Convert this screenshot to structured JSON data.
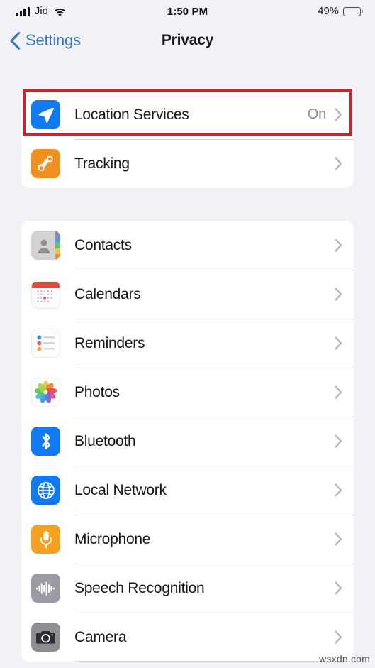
{
  "status_bar": {
    "carrier": "Jio",
    "wifi_icon": "wifi-icon",
    "signal_icon": "cellular-signal-icon",
    "time": "1:50 PM",
    "battery_percent": "49%",
    "battery_level": 49
  },
  "nav": {
    "back_label": "Settings",
    "back_icon": "chevron-left-icon",
    "title": "Privacy"
  },
  "groups": [
    {
      "id": "privacy",
      "rows": [
        {
          "label": "Location Services",
          "value": "On",
          "icon": "location-arrow-icon",
          "icon_class": "ic-location",
          "name": "location-services",
          "highlighted": true
        },
        {
          "label": "Tracking",
          "value": "",
          "icon": "tracking-icon",
          "icon_class": "ic-tracking",
          "name": "tracking",
          "highlighted": false
        }
      ]
    },
    {
      "id": "permissions",
      "rows": [
        {
          "label": "Contacts",
          "value": "",
          "icon": "contacts-icon",
          "icon_class": "ic-contacts",
          "name": "contacts"
        },
        {
          "label": "Calendars",
          "value": "",
          "icon": "calendar-icon",
          "icon_class": "ic-calendars",
          "name": "calendars"
        },
        {
          "label": "Reminders",
          "value": "",
          "icon": "reminders-icon",
          "icon_class": "ic-reminders",
          "name": "reminders"
        },
        {
          "label": "Photos",
          "value": "",
          "icon": "photos-icon",
          "icon_class": "ic-photos",
          "name": "photos"
        },
        {
          "label": "Bluetooth",
          "value": "",
          "icon": "bluetooth-icon",
          "icon_class": "ic-bluetooth",
          "name": "bluetooth"
        },
        {
          "label": "Local Network",
          "value": "",
          "icon": "globe-icon",
          "icon_class": "ic-localnetwork",
          "name": "local-network"
        },
        {
          "label": "Microphone",
          "value": "",
          "icon": "microphone-icon",
          "icon_class": "ic-microphone",
          "name": "microphone"
        },
        {
          "label": "Speech Recognition",
          "value": "",
          "icon": "waveform-icon",
          "icon_class": "ic-speech",
          "name": "speech-recognition"
        },
        {
          "label": "Camera",
          "value": "",
          "icon": "camera-icon",
          "icon_class": "ic-camera",
          "name": "camera"
        }
      ]
    }
  ],
  "annotation": {
    "target": "Location Services",
    "color": "#d12229"
  },
  "watermark": "wsxdn.com"
}
